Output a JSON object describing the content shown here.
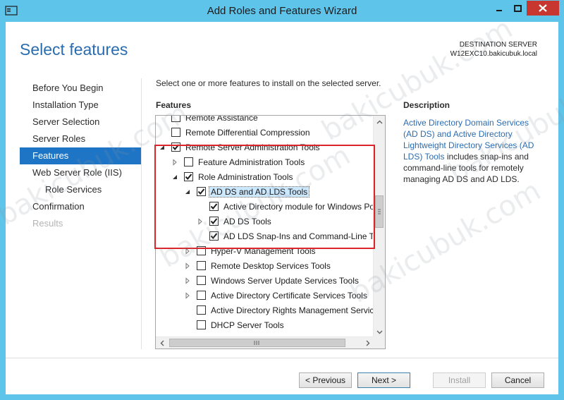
{
  "window": {
    "title": "Add Roles and Features Wizard",
    "accent": "#5fc4ea",
    "close_color": "#c7372f"
  },
  "header": {
    "page_title": "Select features",
    "destination_label": "DESTINATION SERVER",
    "destination_server": "W12EXC10.bakicubuk.local"
  },
  "nav": {
    "items": [
      {
        "label": "Before You Begin",
        "state": "normal"
      },
      {
        "label": "Installation Type",
        "state": "normal"
      },
      {
        "label": "Server Selection",
        "state": "normal"
      },
      {
        "label": "Server Roles",
        "state": "normal"
      },
      {
        "label": "Features",
        "state": "active"
      },
      {
        "label": "Web Server Role (IIS)",
        "state": "normal"
      },
      {
        "label": "Role Services",
        "state": "sub"
      },
      {
        "label": "Confirmation",
        "state": "normal"
      },
      {
        "label": "Results",
        "state": "disabled"
      }
    ]
  },
  "main": {
    "instruction": "Select one or more features to install on the selected server.",
    "features_label": "Features",
    "tree": [
      {
        "label": "Remote Assistance",
        "level": 1,
        "expander": "none",
        "checked": false
      },
      {
        "label": "Remote Differential Compression",
        "level": 1,
        "expander": "none",
        "checked": false
      },
      {
        "label": "Remote Server Administration Tools",
        "level": 1,
        "expander": "expanded",
        "checked": true
      },
      {
        "label": "Feature Administration Tools",
        "level": 2,
        "expander": "collapsed",
        "checked": false
      },
      {
        "label": "Role Administration Tools",
        "level": 2,
        "expander": "expanded",
        "checked": true
      },
      {
        "label": "AD DS and AD LDS Tools",
        "level": 3,
        "expander": "expanded",
        "checked": true,
        "selected": true
      },
      {
        "label": "Active Directory module for Windows PowerShell",
        "level": 4,
        "expander": "none",
        "checked": true
      },
      {
        "label": "AD DS Tools",
        "level": 4,
        "expander": "collapsed",
        "checked": true
      },
      {
        "label": "AD LDS Snap-Ins and Command-Line Tools",
        "level": 4,
        "expander": "none",
        "checked": true
      },
      {
        "label": "Hyper-V Management Tools",
        "level": 3,
        "expander": "collapsed",
        "checked": false
      },
      {
        "label": "Remote Desktop Services Tools",
        "level": 3,
        "expander": "collapsed",
        "checked": false
      },
      {
        "label": "Windows Server Update Services Tools",
        "level": 3,
        "expander": "collapsed",
        "checked": false
      },
      {
        "label": "Active Directory Certificate Services Tools",
        "level": 3,
        "expander": "collapsed",
        "checked": false
      },
      {
        "label": "Active Directory Rights Management Services Tools",
        "level": 3,
        "expander": "none",
        "checked": false
      },
      {
        "label": "DHCP Server Tools",
        "level": 3,
        "expander": "none",
        "checked": false
      }
    ]
  },
  "description": {
    "heading": "Description",
    "link_text": "Active Directory Domain Services (AD DS) and Active Directory Lightweight Directory Services (AD LDS) Tools",
    "body_text": " includes snap-ins and command-line tools for remotely managing AD DS and AD LDS."
  },
  "buttons": {
    "previous": "< Previous",
    "next": "Next >",
    "install": "Install",
    "cancel": "Cancel"
  },
  "watermark": "bakicubuk.com"
}
